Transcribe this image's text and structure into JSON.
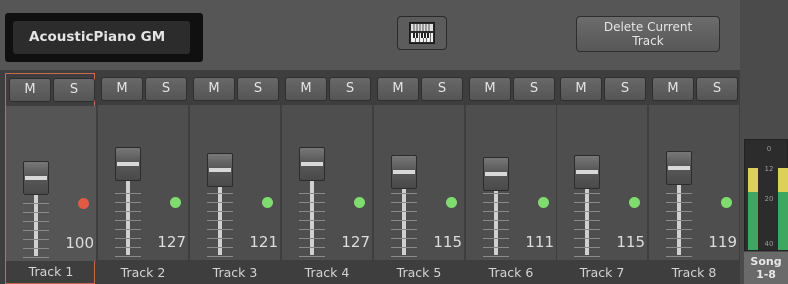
{
  "sound": {
    "name": "AcousticPiano GM"
  },
  "toolbar": {
    "delete_line1": "Delete Current",
    "delete_line2": "Track",
    "keyboard_icon": "keyboard-icon"
  },
  "mixer": {
    "mute_label": "M",
    "solo_label": "S",
    "selected_track_index": 0,
    "tracks": [
      {
        "name": "Track 1",
        "volume": "100",
        "led": "#e05a45"
      },
      {
        "name": "Track 2",
        "volume": "127",
        "led": "#7fdc6e"
      },
      {
        "name": "Track 3",
        "volume": "121",
        "led": "#7fdc6e"
      },
      {
        "name": "Track 4",
        "volume": "127",
        "led": "#7fdc6e"
      },
      {
        "name": "Track 5",
        "volume": "115",
        "led": "#7fdc6e"
      },
      {
        "name": "Track 6",
        "volume": "111",
        "led": "#7fdc6e"
      },
      {
        "name": "Track 7",
        "volume": "115",
        "led": "#7fdc6e"
      },
      {
        "name": "Track 8",
        "volume": "119",
        "led": "#7fdc6e"
      }
    ]
  },
  "meter": {
    "labels": [
      "0",
      "12",
      "20",
      "40"
    ]
  },
  "song_button": {
    "line1": "Song",
    "line2": "1-8"
  }
}
